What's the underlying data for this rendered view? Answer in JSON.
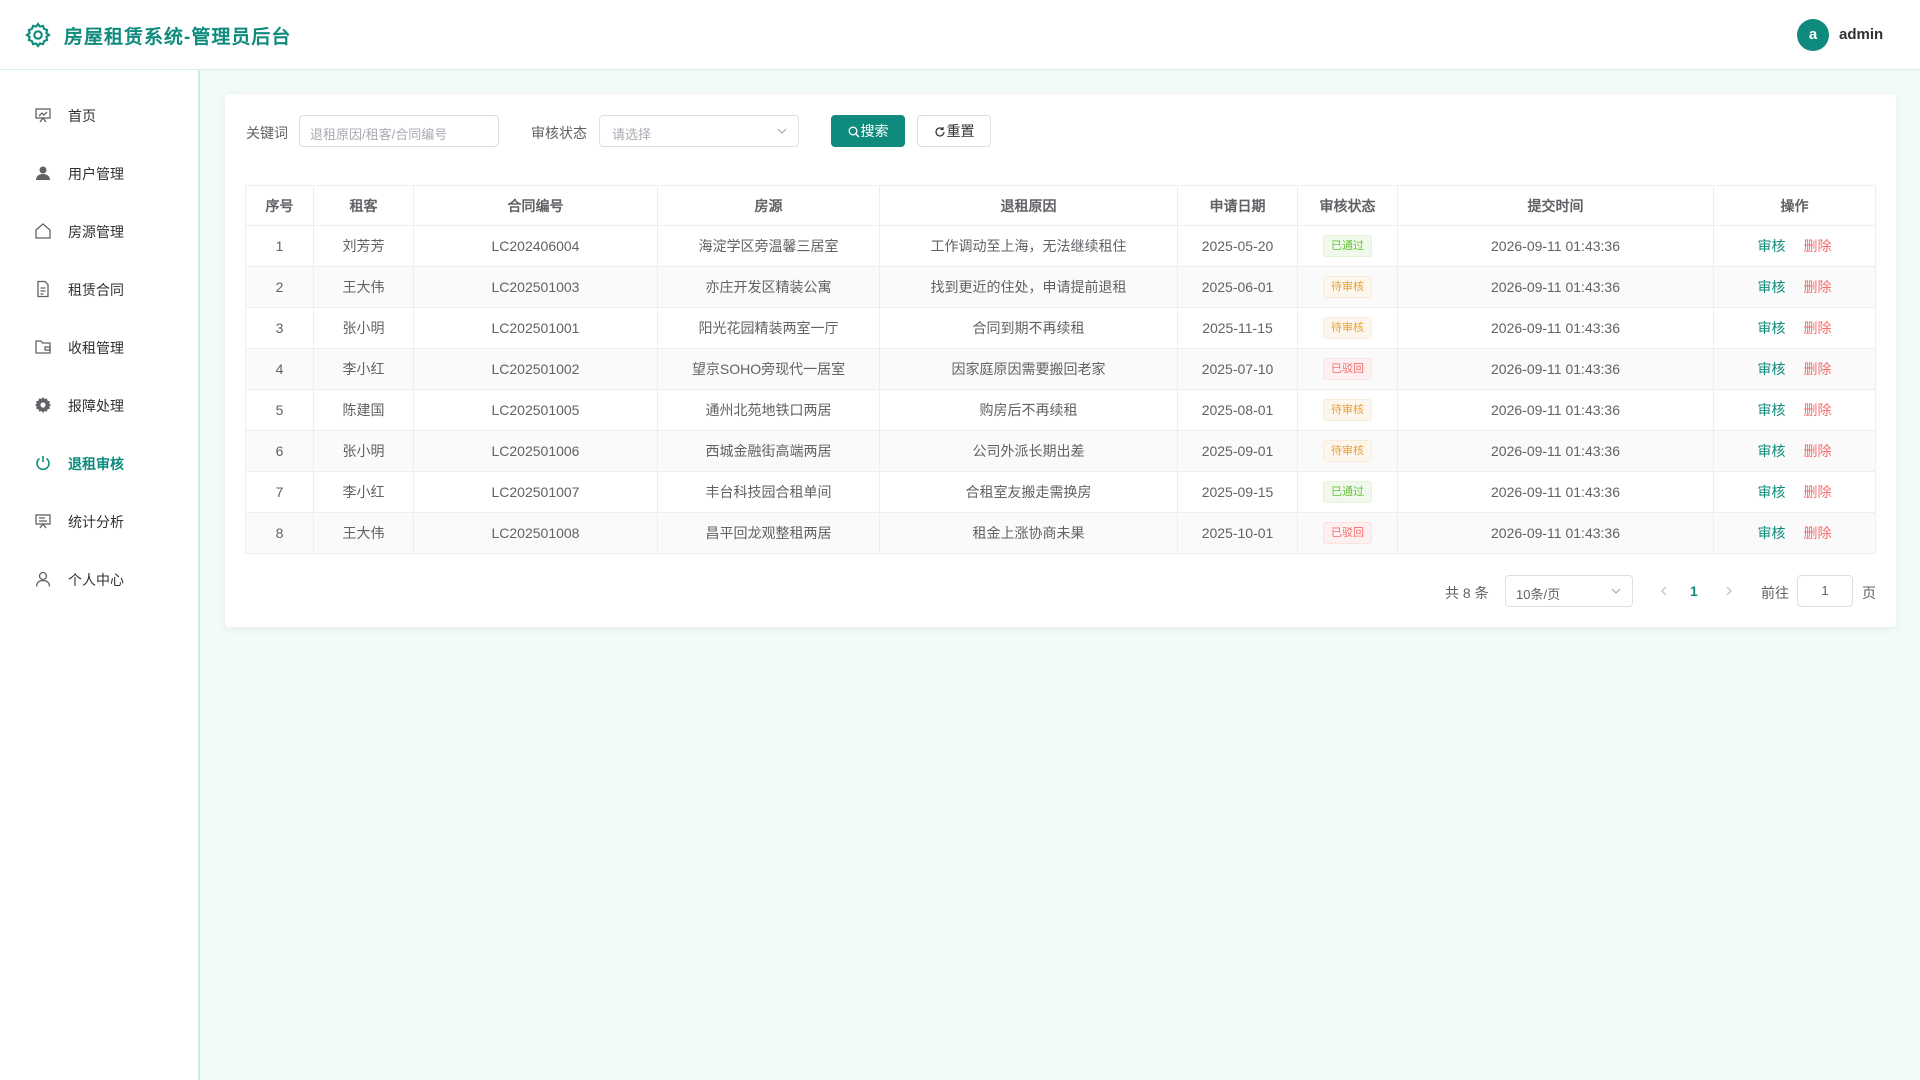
{
  "header": {
    "title": "房屋租赁系统-管理员后台",
    "avatar_letter": "a",
    "username": "admin"
  },
  "sidebar": {
    "items": [
      {
        "label": "首页",
        "icon": "dashboard-icon"
      },
      {
        "label": "用户管理",
        "icon": "user-icon"
      },
      {
        "label": "房源管理",
        "icon": "house-icon"
      },
      {
        "label": "租赁合同",
        "icon": "document-icon"
      },
      {
        "label": "收租管理",
        "icon": "folder-icon"
      },
      {
        "label": "报障处理",
        "icon": "gear-icon"
      },
      {
        "label": "退租审核",
        "icon": "power-icon",
        "active": true
      },
      {
        "label": "统计分析",
        "icon": "chart-icon"
      },
      {
        "label": "个人中心",
        "icon": "person-icon"
      }
    ]
  },
  "filters": {
    "keyword_label": "关键词",
    "keyword_placeholder": "退租原因/租客/合同编号",
    "status_label": "审核状态",
    "status_placeholder": "请选择",
    "search_label": "搜索",
    "reset_label": "重置"
  },
  "table": {
    "columns": [
      "序号",
      "租客",
      "合同编号",
      "房源",
      "退租原因",
      "申请日期",
      "审核状态",
      "提交时间",
      "操作"
    ],
    "review_label": "审核",
    "delete_label": "删除",
    "rows": [
      {
        "no": "1",
        "tenant": "刘芳芳",
        "contract": "LC202406004",
        "property": "海淀学区旁温馨三居室",
        "reason": "工作调动至上海，无法继续租住",
        "date": "2025-05-20",
        "status": "已通过",
        "status_type": "success",
        "submitted": "2026-09-11 01:43:36"
      },
      {
        "no": "2",
        "tenant": "王大伟",
        "contract": "LC202501003",
        "property": "亦庄开发区精装公寓",
        "reason": "找到更近的住处，申请提前退租",
        "date": "2025-06-01",
        "status": "待审核",
        "status_type": "warning",
        "submitted": "2026-09-11 01:43:36"
      },
      {
        "no": "3",
        "tenant": "张小明",
        "contract": "LC202501001",
        "property": "阳光花园精装两室一厅",
        "reason": "合同到期不再续租",
        "date": "2025-11-15",
        "status": "待审核",
        "status_type": "warning",
        "submitted": "2026-09-11 01:43:36"
      },
      {
        "no": "4",
        "tenant": "李小红",
        "contract": "LC202501002",
        "property": "望京SOHO旁现代一居室",
        "reason": "因家庭原因需要搬回老家",
        "date": "2025-07-10",
        "status": "已驳回",
        "status_type": "danger",
        "submitted": "2026-09-11 01:43:36"
      },
      {
        "no": "5",
        "tenant": "陈建国",
        "contract": "LC202501005",
        "property": "通州北苑地铁口两居",
        "reason": "购房后不再续租",
        "date": "2025-08-01",
        "status": "待审核",
        "status_type": "warning",
        "submitted": "2026-09-11 01:43:36"
      },
      {
        "no": "6",
        "tenant": "张小明",
        "contract": "LC202501006",
        "property": "西城金融街高端两居",
        "reason": "公司外派长期出差",
        "date": "2025-09-01",
        "status": "待审核",
        "status_type": "warning",
        "submitted": "2026-09-11 01:43:36"
      },
      {
        "no": "7",
        "tenant": "李小红",
        "contract": "LC202501007",
        "property": "丰台科技园合租单间",
        "reason": "合租室友搬走需换房",
        "date": "2025-09-15",
        "status": "已通过",
        "status_type": "success",
        "submitted": "2026-09-11 01:43:36"
      },
      {
        "no": "8",
        "tenant": "王大伟",
        "contract": "LC202501008",
        "property": "昌平回龙观整租两居",
        "reason": "租金上涨协商未果",
        "date": "2025-10-01",
        "status": "已驳回",
        "status_type": "danger",
        "submitted": "2026-09-11 01:43:36"
      }
    ]
  },
  "pagination": {
    "total_text": "共 8 条",
    "page_size": "10条/页",
    "current_page": "1",
    "goto_label": "前往",
    "goto_value": "1",
    "page_suffix": "页"
  },
  "colors": {
    "accent": "#0f8b7d",
    "success": "#67c23a",
    "warning": "#e6a23c",
    "danger": "#f56c6c"
  }
}
